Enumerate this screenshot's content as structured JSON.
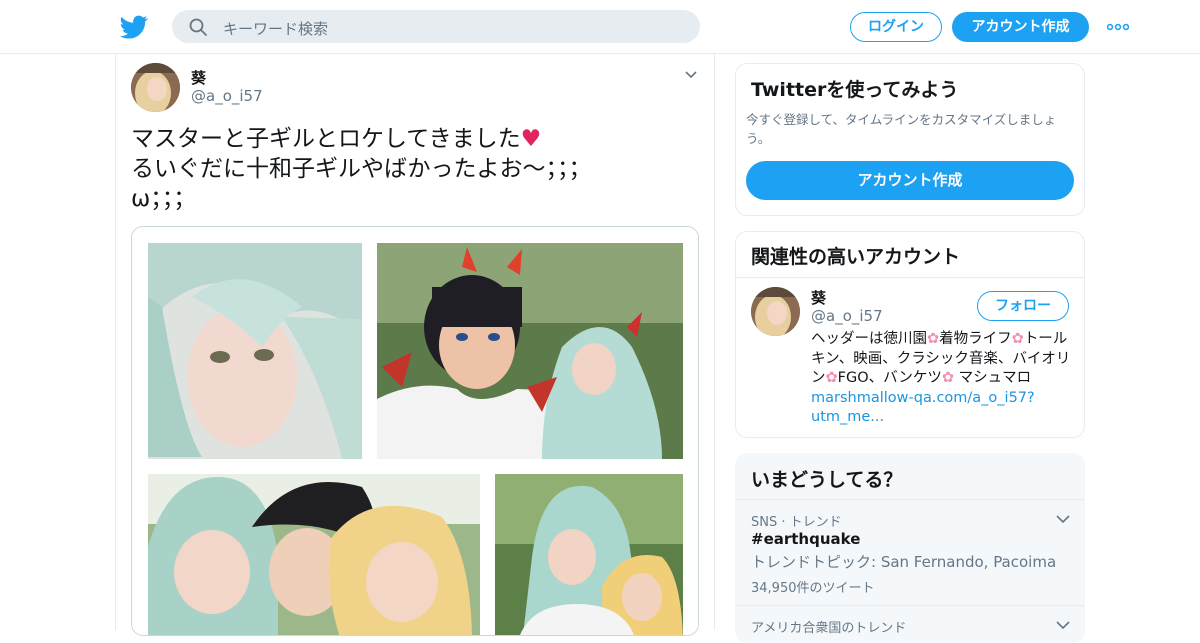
{
  "header": {
    "search_placeholder": "キーワード検索",
    "login_label": "ログイン",
    "signup_label": "アカウント作成"
  },
  "tweet": {
    "display_name": "葵",
    "handle": "@a_o_i57",
    "text_line1": "マスターと子ギルとロケしてきました",
    "text_line2": "るいぐだに十和子ギルやばかったよお〜；；；",
    "text_line3": "ω；；；",
    "heart": "♥"
  },
  "sidebar": {
    "signup_card": {
      "title": "Twitterを使ってみよう",
      "subtitle": "今すぐ登録して、タイムラインをカスタマイズしましょう。",
      "button": "アカウント作成"
    },
    "related_card": {
      "title": "関連性の高いアカウント",
      "name": "葵",
      "handle": "@a_o_i57",
      "follow": "フォロー",
      "bio_1": "ヘッダーは徳川園",
      "bio_2": "着物ライフ",
      "bio_3": "トールキン、映画、クラシック音楽、バイオリン",
      "bio_4": "FGO、バンケツ",
      "bio_5": " マシュマロ",
      "bio_link": "marshmallow-qa.com/a_o_i57?utm_me...",
      "flower": "✿"
    },
    "trends_card": {
      "title": "いまどうしてる？",
      "trend1_meta": "SNS · トレンド",
      "trend1_name": "#earthquake",
      "trend1_desc": "トレンドトピック: San Fernando, Pacoima",
      "trend1_count": "34,950件のツイート",
      "trend2_meta": "アメリカ合衆国のトレンド"
    }
  },
  "colors": {
    "accent": "#1da1f2",
    "text": "#14171a",
    "muted": "#657786",
    "border": "#e6ecf0"
  }
}
